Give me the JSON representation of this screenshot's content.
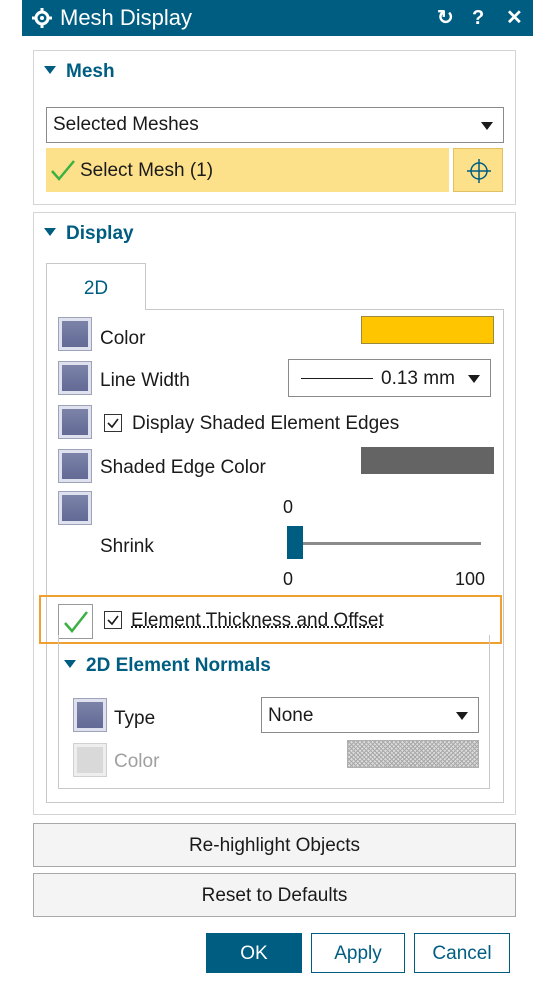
{
  "window": {
    "title": "Mesh Display",
    "reset_glyph": "↻",
    "help_glyph": "?",
    "close_glyph": "✕"
  },
  "mesh": {
    "heading": "Mesh",
    "filter_value": "Selected Meshes",
    "select_label": "Select Mesh (1)",
    "select_highlight_color": "#fde18a"
  },
  "display": {
    "heading": "Display",
    "tab": "2D",
    "color_label": "Color",
    "color_value": "#ffc600",
    "line_width_label": "Line Width",
    "line_width_value": "0.13 mm",
    "shaded_edges_label": "Display Shaded Element Edges",
    "shaded_edges_checked": true,
    "shaded_edge_color_label": "Shaded Edge Color",
    "shaded_edge_color": "#646464",
    "shrink_label": "Shrink",
    "shrink_value": "0",
    "shrink_min": "0",
    "shrink_max": "100",
    "thickness_label": "Element Thickness and Offset",
    "thickness_checked": true,
    "normals": {
      "heading": "2D Element Normals",
      "type_label": "Type",
      "type_value": "None",
      "color_label": "Color"
    }
  },
  "buttons": {
    "rehighlight": "Re-highlight Objects",
    "reset": "Reset to Defaults",
    "ok": "OK",
    "apply": "Apply",
    "cancel": "Cancel"
  },
  "colors": {
    "accent": "#005d82",
    "highlight_border": "#f0a030"
  }
}
